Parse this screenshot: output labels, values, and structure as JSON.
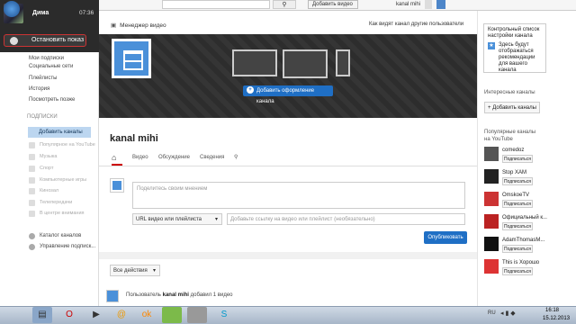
{
  "guide": {
    "user_name": "Дима",
    "user_time": "07:36",
    "stop_show": "Остановить показ",
    "links": [
      "Мои подписки",
      "Социальные сети",
      "Плейлисты",
      "История",
      "Посмотреть позже"
    ],
    "subscriptions_head": "ПОДПИСКИ",
    "add_channels": "Добавить каналы",
    "subscriptions": [
      "Популярное на YouTube",
      "Музыка",
      "Спорт",
      "Компьютерные игры",
      "Кинозал",
      "Телепередачи",
      "В центре внимания"
    ],
    "footer": [
      "Каталог каналов",
      "Управление подписк..."
    ]
  },
  "topbar": {
    "upload": "Добавить видео",
    "user": "kanal mihi",
    "search_icon": "search-icon"
  },
  "header": {
    "video_manager": "Менеджер видео",
    "view_as": "Как видят канал другие пользователи"
  },
  "banner": {
    "add_art": "Добавить оформление канала"
  },
  "channel": {
    "name": "kanal mihi",
    "tabs": [
      "Видео",
      "Обсуждение",
      "Сведения"
    ]
  },
  "share": {
    "placeholder": "Поделитесь своим мнением",
    "playlist_select": "URL видео или плейлиста",
    "link_placeholder": "Добавьте ссылку на видео или плейлист (необязательно)",
    "publish": "Опубликовать"
  },
  "feed": {
    "filter": "Все действия",
    "item_prefix": "Пользователь ",
    "item_user": "kanal mihi",
    "item_suffix": " добавил 1 видео"
  },
  "right": {
    "checklist_title": "Контрольный список настройки канала",
    "checklist_text": "Здесь будут отображаться рекомендации для вашего канала",
    "interesting": "Интересные каналы",
    "interesting_add": "+ Добавить каналы",
    "popular": "Популярные каналы на YouTube",
    "subscribe": "Подписаться",
    "channels": [
      "comedoz",
      "Stop ХАМ",
      "OmskoeTV",
      "Официальный к...",
      "AdamThomasM...",
      "This is Хорошо"
    ]
  },
  "taskbar": {
    "lang": "RU",
    "time": "16:18",
    "date": "15.12.2013"
  }
}
